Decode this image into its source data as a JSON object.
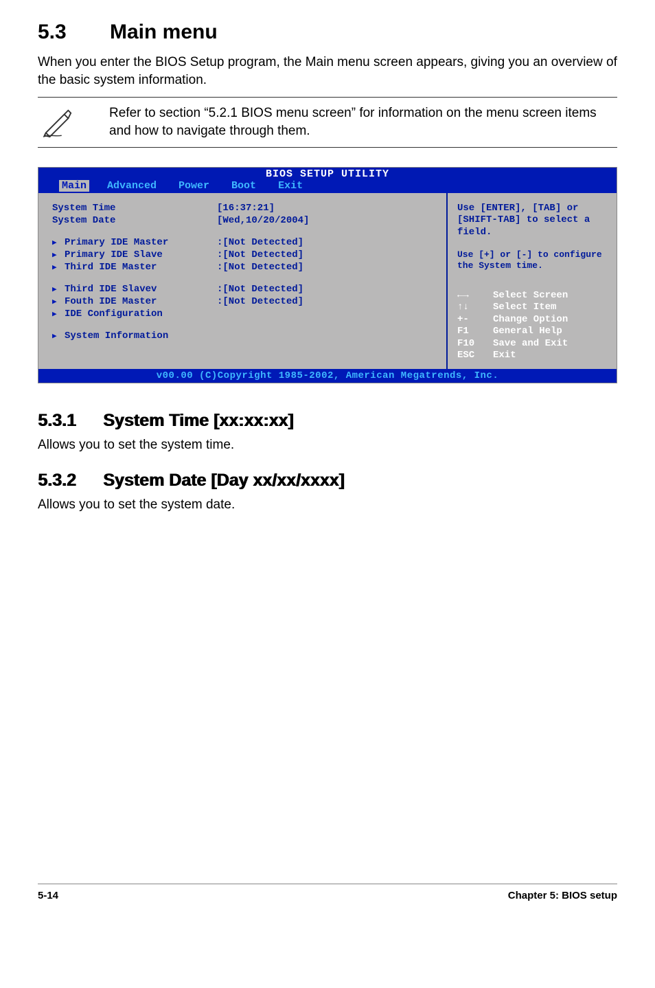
{
  "heading": {
    "num": "5.3",
    "title": "Main menu"
  },
  "intro": "When you enter the BIOS Setup program, the Main menu screen appears, giving you an overview of the basic system information.",
  "note": "Refer to section “5.2.1  BIOS menu screen” for information on the menu screen items and how to navigate through them.",
  "bios": {
    "header": "BIOS SETUP UTILITY",
    "tabs": [
      "Main",
      "Advanced",
      "Power",
      "Boot",
      "Exit"
    ],
    "selected_tab": "Main",
    "left": {
      "system_time_label": "System Time",
      "system_time_value": "[16:37:21]",
      "system_date_label": "System Date",
      "system_date_value": "[Wed,10/20/2004]",
      "rows": [
        {
          "label": "Primary IDE Master",
          "value": ":[Not Detected]"
        },
        {
          "label": "Primary IDE Slave",
          "value": ":[Not Detected]"
        },
        {
          "label": "Third IDE Master",
          "value": ":[Not Detected]"
        },
        {
          "label": "Third IDE Slavev",
          "value": ":[Not Detected]"
        },
        {
          "label": "Fouth IDE Master",
          "value": ":[Not Detected]"
        },
        {
          "label": "IDE Configuration",
          "value": ""
        }
      ],
      "sysinfo": "System Information"
    },
    "right": {
      "help1": "Use [ENTER], [TAB] or [SHIFT-TAB] to select a field.",
      "help2": "Use [+] or [-] to configure the System time.",
      "keys": [
        {
          "k": "←→",
          "d": "Select Screen"
        },
        {
          "k": "↑↓",
          "d": "Select Item"
        },
        {
          "k": "+-",
          "d": "Change Option"
        },
        {
          "k": "F1",
          "d": "General Help"
        },
        {
          "k": "F10",
          "d": "Save and Exit"
        },
        {
          "k": "ESC",
          "d": "Exit"
        }
      ]
    },
    "footer": "v00.00 (C)Copyright 1985-2002, American Megatrends, Inc."
  },
  "sec1": {
    "num": "5.3.1",
    "title": "System Time [xx:xx:xx]",
    "text": "Allows you to set the system time."
  },
  "sec2": {
    "num": "5.3.2",
    "title": "System Date [Day xx/xx/xxxx]",
    "text": "Allows you to set the system date."
  },
  "footer": {
    "page": "5-14",
    "chapter": "Chapter 5: BIOS setup"
  }
}
